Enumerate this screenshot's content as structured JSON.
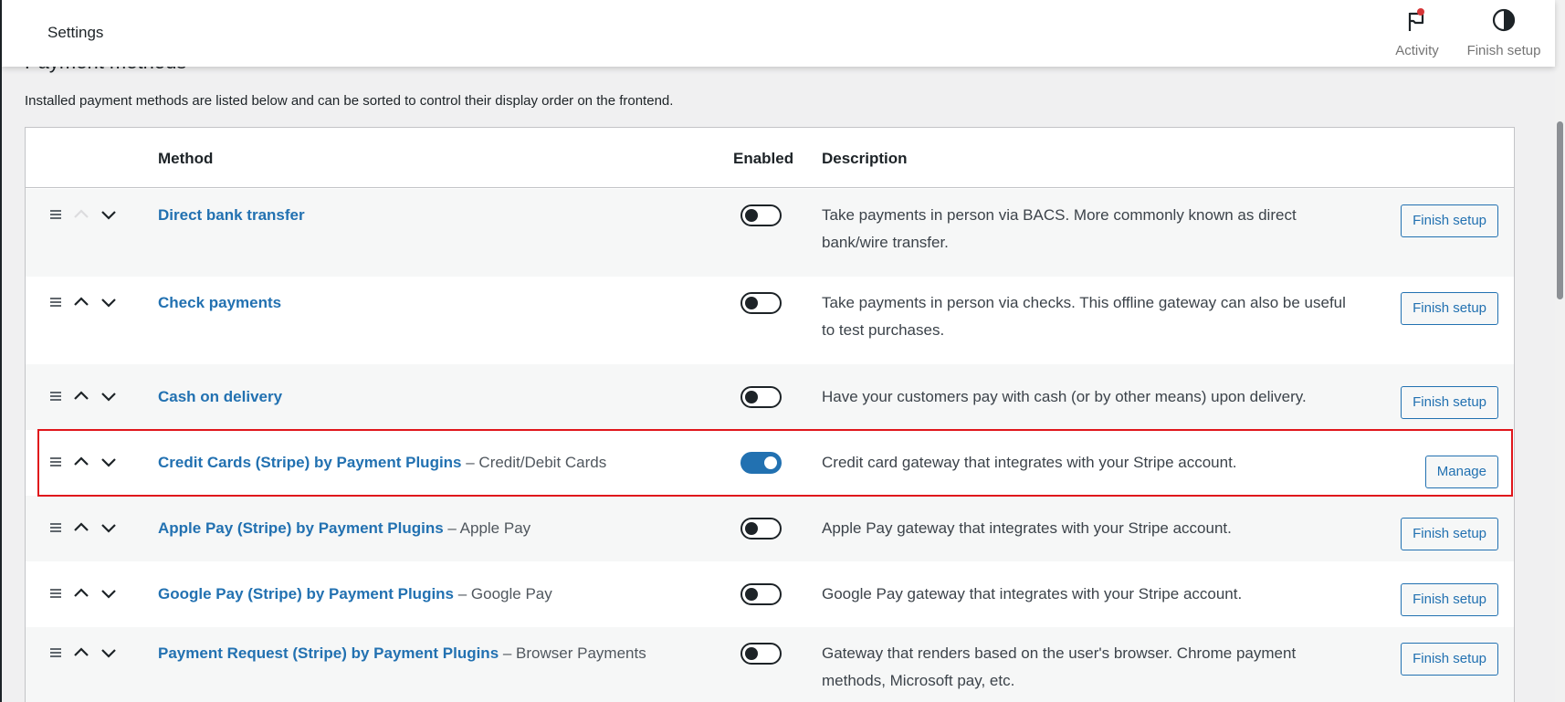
{
  "topbar": {
    "title": "Settings",
    "activity_label": "Activity",
    "finish_setup_label": "Finish setup"
  },
  "section": {
    "heading": "Payment methods",
    "description": "Installed payment methods are listed below and can be sorted to control their display order on the frontend."
  },
  "table": {
    "headers": {
      "method": "Method",
      "enabled": "Enabled",
      "description": "Description"
    },
    "rows": [
      {
        "name": "Direct bank transfer",
        "suffix": "",
        "enabled": false,
        "description": "Take payments in person via BACS. More commonly known as direct bank/wire transfer.",
        "action": "Finish setup",
        "up_disabled": true
      },
      {
        "name": "Check payments",
        "suffix": "",
        "enabled": false,
        "description": "Take payments in person via checks. This offline gateway can also be useful to test purchases.",
        "action": "Finish setup",
        "up_disabled": false
      },
      {
        "name": "Cash on delivery",
        "suffix": "",
        "enabled": false,
        "description": "Have your customers pay with cash (or by other means) upon delivery.",
        "action": "Finish setup",
        "up_disabled": false
      },
      {
        "name": "Credit Cards (Stripe) by Payment Plugins",
        "suffix": " – Credit/Debit Cards",
        "enabled": true,
        "description": "Credit card gateway that integrates with your Stripe account.",
        "action": "Manage",
        "up_disabled": false
      },
      {
        "name": "Apple Pay (Stripe) by Payment Plugins",
        "suffix": " – Apple Pay",
        "enabled": false,
        "description": "Apple Pay gateway that integrates with your Stripe account.",
        "action": "Finish setup",
        "up_disabled": false
      },
      {
        "name": "Google Pay (Stripe) by Payment Plugins",
        "suffix": " – Google Pay",
        "enabled": false,
        "description": "Google Pay gateway that integrates with your Stripe account.",
        "action": "Finish setup",
        "up_disabled": false
      },
      {
        "name": "Payment Request (Stripe) by Payment Plugins",
        "suffix": " – Browser Payments",
        "enabled": false,
        "description": "Gateway that renders based on the user's browser. Chrome payment methods, Microsoft pay, etc.",
        "action": "Finish setup",
        "up_disabled": false
      }
    ]
  },
  "colors": {
    "accent": "#2271b1",
    "highlight": "#e0161b",
    "notification_dot": "#d63638"
  },
  "icons": [
    "flag-icon",
    "half-circle-icon",
    "drag-handle-icon",
    "chevron-up-icon",
    "chevron-down-icon"
  ]
}
